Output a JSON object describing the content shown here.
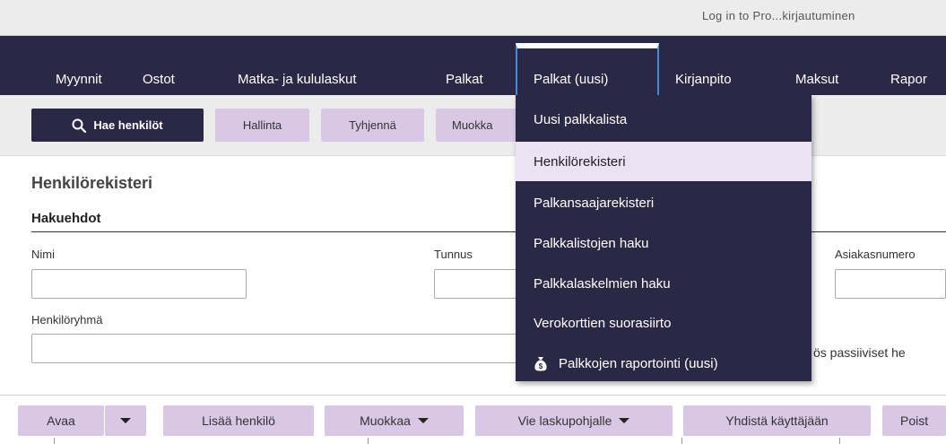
{
  "topbar": {
    "login_link": "Log in to Pro...kirjautuminen"
  },
  "nav": {
    "items": [
      "Myynnit",
      "Ostot",
      "Matka- ja kululaskut",
      "Palkat",
      "Palkat (uusi)",
      "Kirjanpito",
      "Maksut",
      "Rapor"
    ],
    "active_index": 4
  },
  "toolbar": {
    "search_button": "Hae henkilöt",
    "manage_button": "Hallinta",
    "clear_button": "Tyhjennä",
    "edit_button": "Muokka"
  },
  "dropdown": {
    "items": [
      "Uusi palkkalista",
      "Henkilörekisteri",
      "Palkansaajarekisteri",
      "Palkkalistojen haku",
      "Palkkalaskelmien haku",
      "Verokorttien suorasiirto",
      "Palkkojen raportointi (uusi)"
    ],
    "highlighted_index": 1
  },
  "form": {
    "title": "Henkilörekisteri",
    "subtitle": "Hakuehdot",
    "name_label": "Nimi",
    "id_label": "Tunnus",
    "customer_label": "Asiakasnumero",
    "group_label": "Henkilöryhmä",
    "passive_text": "ös passiiviset he",
    "name_value": "",
    "id_value": "",
    "customer_value": "",
    "group_value": ""
  },
  "actions": {
    "open": "Avaa",
    "add_person": "Lisää henkilö",
    "edit": "Muokkaa",
    "export": "Vie laskupohjalle",
    "link_user": "Yhdistä käyttäjään",
    "delete": "Poist"
  },
  "colors": {
    "nav_bg": "#2b2845",
    "button_light": "#d9c7e6",
    "dropdown_highlight": "#ede2f3",
    "active_border": "#3e8ee0"
  }
}
